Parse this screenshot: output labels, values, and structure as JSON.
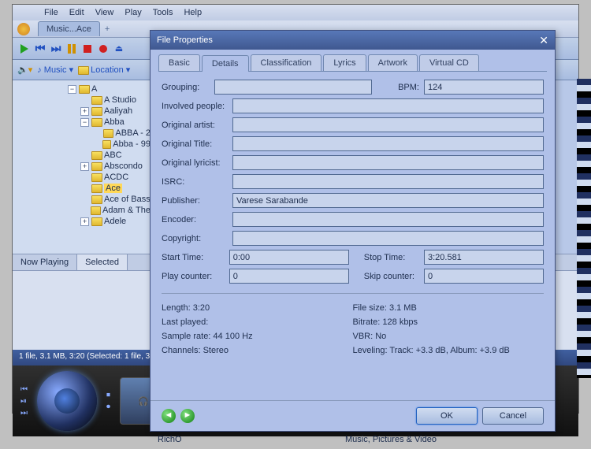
{
  "window": {
    "tab_label": "Music...Ace",
    "menus": [
      "File",
      "Edit",
      "View",
      "Play",
      "Tools",
      "Help"
    ]
  },
  "nav": {
    "music": "Music",
    "location": "Location"
  },
  "tree": {
    "root": "A",
    "items": [
      {
        "label": "A Studio",
        "exp": "none",
        "indent": 1
      },
      {
        "label": "Aaliyah",
        "exp": "plus",
        "indent": 1
      },
      {
        "label": "Abba",
        "exp": "minus",
        "indent": 1
      },
      {
        "label": "ABBA - 2",
        "exp": "none",
        "indent": 2
      },
      {
        "label": "Abba - 99",
        "exp": "none",
        "indent": 2
      },
      {
        "label": "ABC",
        "exp": "none",
        "indent": 1
      },
      {
        "label": "Abscondo",
        "exp": "plus",
        "indent": 1
      },
      {
        "label": "ACDC",
        "exp": "none",
        "indent": 1
      },
      {
        "label": "Ace",
        "exp": "none",
        "indent": 1,
        "selected": true
      },
      {
        "label": "Ace of Bass",
        "exp": "none",
        "indent": 1
      },
      {
        "label": "Adam & The",
        "exp": "none",
        "indent": 1
      },
      {
        "label": "Adele",
        "exp": "plus",
        "indent": 1
      }
    ]
  },
  "bottom_tabs": {
    "now_playing": "Now Playing",
    "selected": "Selected"
  },
  "status": "1 file, 3.1 MB, 3:20 (Selected: 1 file, 3.1…",
  "dialog": {
    "title": "File Properties",
    "tabs": [
      "Basic",
      "Details",
      "Classification",
      "Lyrics",
      "Artwork",
      "Virtual CD"
    ],
    "active_tab": 1,
    "fields": {
      "grouping_l": "Grouping:",
      "grouping": "",
      "bpm_l": "BPM:",
      "bpm": "124",
      "involved_l": "Involved people:",
      "involved": "",
      "origartist_l": "Original artist:",
      "origartist": "",
      "origtitle_l": "Original Title:",
      "origtitle": "",
      "origlyr_l": "Original lyricist:",
      "origlyr": "",
      "isrc_l": "ISRC:",
      "isrc": "",
      "publisher_l": "Publisher:",
      "publisher": "Varese Sarabande",
      "encoder_l": "Encoder:",
      "encoder": "",
      "copyright_l": "Copyright:",
      "copyright": "",
      "start_l": "Start Time:",
      "start": "0:00",
      "stop_l": "Stop Time:",
      "stop": "3:20.581",
      "playcount_l": "Play counter:",
      "playcount": "0",
      "skipcount_l": "Skip counter:",
      "skipcount": "0"
    },
    "info": {
      "length": "Length: 3:20",
      "filesize": "File size: 3.1 MB",
      "lastplayed": "Last played:",
      "bitrate": "Bitrate: 128 kbps",
      "samplerate": "Sample rate: 44 100 Hz",
      "vbr": "VBR: No",
      "channels": "Channels: Stereo",
      "leveling": "Leveling: Track: +3.3 dB, Album: +3.9 dB"
    },
    "ok": "OK",
    "cancel": "Cancel"
  },
  "footer": {
    "a": "RichO",
    "b": "Music, Pictures & Video"
  }
}
